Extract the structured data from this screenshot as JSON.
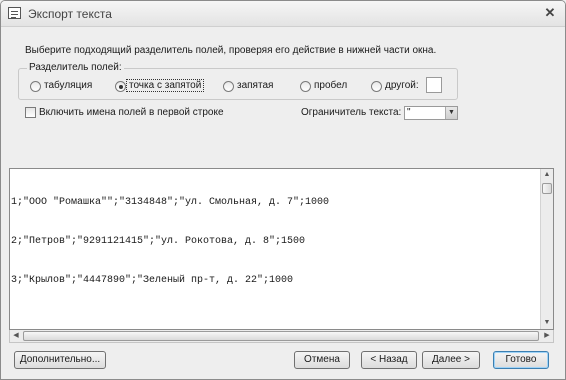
{
  "window": {
    "title": "Экспорт текста",
    "close_symbol": "✕"
  },
  "instruction": "Выберите подходящий разделитель полей, проверяя его действие в нижней части окна.",
  "delimiter_group": {
    "legend": "Разделитель полей:",
    "options": [
      {
        "label": "табуляция",
        "checked": false
      },
      {
        "label": "точка с запятой",
        "checked": true
      },
      {
        "label": "запятая",
        "checked": false
      },
      {
        "label": "пробел",
        "checked": false
      },
      {
        "label": "другой:",
        "checked": false
      }
    ],
    "other_value": ""
  },
  "include_field_names": {
    "label": "Включить имена полей в первой строке",
    "checked": false
  },
  "text_qualifier": {
    "label": "Ограничитель текста:",
    "value": "\""
  },
  "preview_lines": [
    "1;\"ООО \"Ромашка\"\";\"3134848\";\"ул. Смольная, д. 7\";1000",
    "2;\"Петров\";\"9291121415\";\"ул. Рокотова, д. 8\";1500",
    "3;\"Крылов\";\"4447890\";\"Зеленый пр-т, д. 22\";1000"
  ],
  "buttons": {
    "advanced": "Дополнительно...",
    "cancel": "Отмена",
    "back": "< Назад",
    "next": "Далее >",
    "finish": "Готово"
  },
  "icons": {
    "window": "dialog-icon",
    "close": "close-icon",
    "scroll_up": "arrow-up-icon",
    "scroll_down": "arrow-down-icon",
    "scroll_left": "arrow-left-icon",
    "scroll_right": "arrow-right-icon",
    "dropdown": "chevron-down-icon"
  }
}
